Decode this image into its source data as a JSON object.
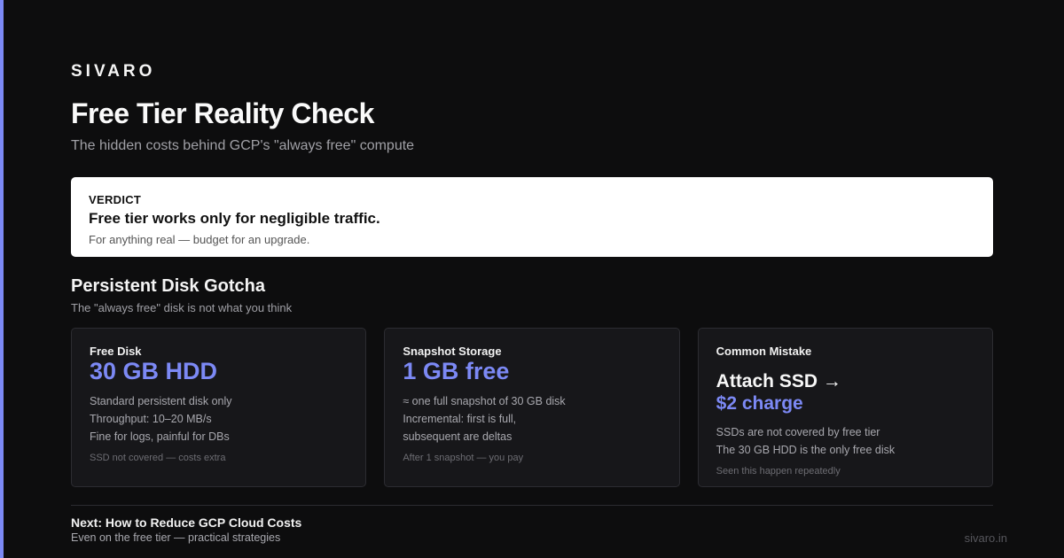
{
  "brand": "SIVARO",
  "title": "Free Tier Reality Check",
  "subtitle": "The hidden costs behind GCP's \"always free\" compute",
  "verdict": {
    "label": "VERDICT",
    "headline": "Free tier works only for negligible traffic.",
    "note": "For anything real — budget for an upgrade."
  },
  "section": {
    "title": "Persistent Disk Gotcha",
    "subtitle": "The \"always free\" disk is not what you think"
  },
  "cards": [
    {
      "label": "Free Disk",
      "big": "30 GB HDD",
      "lines": [
        "Standard persistent disk only",
        "Throughput: 10–20 MB/s",
        "Fine for logs, painful for DBs"
      ],
      "foot": "SSD not covered — costs extra"
    },
    {
      "label": "Snapshot Storage",
      "big": "1 GB free",
      "lines": [
        "≈ one full snapshot of 30 GB disk",
        "Incremental: first is full,",
        "subsequent are deltas"
      ],
      "foot": "After 1 snapshot — you pay"
    },
    {
      "label": "Common Mistake",
      "big_line1": "Attach SSD →",
      "big_line2": "$2 charge",
      "lines": [
        "SSDs are not covered by free tier",
        "The 30 GB HDD is the only free disk"
      ],
      "foot": "Seen this happen repeatedly"
    }
  ],
  "next": {
    "title": "Next: How to Reduce GCP Cloud Costs",
    "subtitle": "Even on the free tier — practical strategies"
  },
  "domain": "sivaro.in",
  "colors": {
    "accent": "#7c89f5",
    "background": "#0d0d0e",
    "card": "#17171a"
  }
}
